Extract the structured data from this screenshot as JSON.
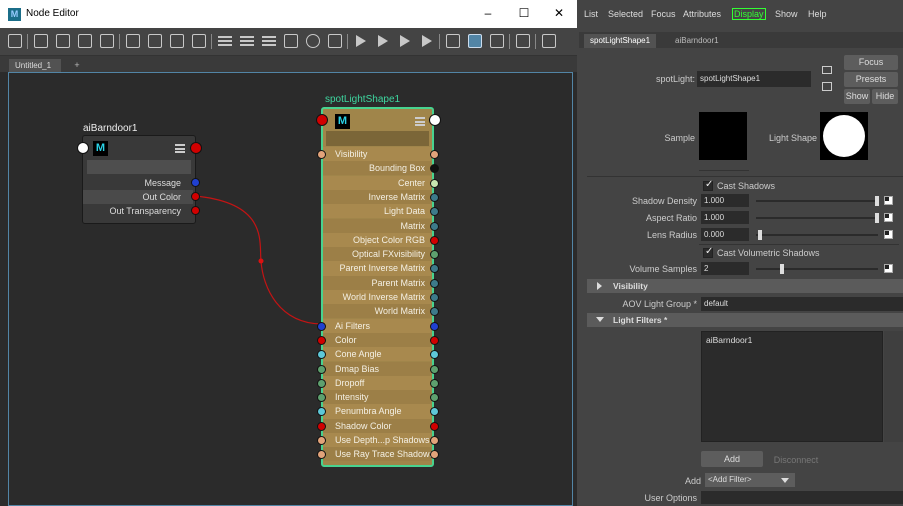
{
  "node_editor": {
    "title": "Node Editor",
    "window_buttons": [
      "–",
      "☐",
      "✕"
    ],
    "tab": "Untitled_1",
    "tab_add": "+",
    "barn_node": {
      "name": "aiBarndoor1",
      "attributes": [
        "Message",
        "Out Color",
        "Out Transparency"
      ]
    },
    "spot_node": {
      "name": "spotLightShape1",
      "attributes": [
        {
          "label": "Visibility",
          "align": "left"
        },
        {
          "label": "Bounding Box",
          "align": "right"
        },
        {
          "label": "Center",
          "align": "right"
        },
        {
          "label": "Inverse Matrix",
          "align": "right"
        },
        {
          "label": "Light Data",
          "align": "right"
        },
        {
          "label": "Matrix",
          "align": "right"
        },
        {
          "label": "Object Color RGB",
          "align": "right"
        },
        {
          "label": "Optical FXvisibility",
          "align": "right"
        },
        {
          "label": "Parent Inverse Matrix",
          "align": "right"
        },
        {
          "label": "Parent Matrix",
          "align": "right"
        },
        {
          "label": "World Inverse Matrix",
          "align": "right"
        },
        {
          "label": "World Matrix",
          "align": "right"
        },
        {
          "label": "Ai Filters",
          "align": "left"
        },
        {
          "label": "Color",
          "align": "left"
        },
        {
          "label": "Cone Angle",
          "align": "left"
        },
        {
          "label": "Dmap Bias",
          "align": "left"
        },
        {
          "label": "Dropoff",
          "align": "left"
        },
        {
          "label": "Intensity",
          "align": "left"
        },
        {
          "label": "Penumbra Angle",
          "align": "left"
        },
        {
          "label": "Shadow Color",
          "align": "left"
        },
        {
          "label": "Use Depth...p Shadows",
          "align": "left"
        },
        {
          "label": "Use Ray Trace Shadows",
          "align": "left"
        }
      ]
    },
    "badge_letter": "M"
  },
  "attribute_editor": {
    "menu": [
      "List",
      "Selected",
      "Focus",
      "Attributes",
      "Display",
      "Show",
      "Help"
    ],
    "tabs": [
      "spotLightShape1",
      "aiBarndoor1"
    ],
    "spotlight_label": "spotLight:",
    "spotlight_value": "spotLightShape1",
    "buttons": {
      "focus": "Focus",
      "presets": "Presets",
      "show": "Show",
      "hide": "Hide"
    },
    "sample_label": "Sample",
    "light_shape_label": "Light Shape",
    "cast_shadows": "Cast Shadows",
    "shadow_density_label": "Shadow Density",
    "shadow_density": "1.000",
    "aspect_ratio_label": "Aspect Ratio",
    "aspect_ratio": "1.000",
    "lens_radius_label": "Lens Radius",
    "lens_radius": "0.000",
    "cast_volumetric": "Cast Volumetric Shadows",
    "volume_samples_label": "Volume Samples",
    "volume_samples": "2",
    "visibility_section": "Visibility",
    "aov_label": "AOV Light Group *",
    "aov_value": "default",
    "light_filters_section": "Light Filters *",
    "filter_list": [
      "aiBarndoor1"
    ],
    "add_button": "Add",
    "disconnect_button": "Disconnect",
    "add_label": "Add",
    "add_filter_option": "<Add Filter>",
    "user_options_label": "User Options"
  }
}
